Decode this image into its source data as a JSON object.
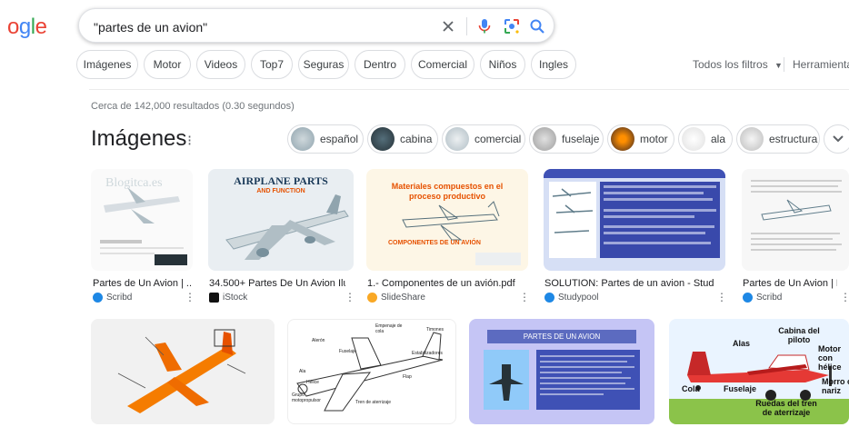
{
  "logo": {
    "part1": "o",
    "part2": "g",
    "part3": "l",
    "part4": "e"
  },
  "search": {
    "value": "\"partes de un avion\""
  },
  "chips": [
    "Imágenes",
    "Motor",
    "Videos",
    "Top7",
    "Seguras",
    "Dentro",
    "Comercial",
    "Niños",
    "Ingles"
  ],
  "tools": {
    "filters": "Todos los filtros",
    "herramientas": "Herramientas"
  },
  "stats": "Cerca de 142,000 resultados (0.30 segundos)",
  "images_section": {
    "title": "Imágenes",
    "pills": [
      "español",
      "cabina",
      "comercial",
      "fuselaje",
      "motor",
      "ala",
      "estructura"
    ]
  },
  "results": [
    {
      "caption": "Partes de Un Avion | ...",
      "source": "Scribd",
      "image_text": [
        "Blogitca.es"
      ]
    },
    {
      "caption": "34.500+ Partes De Un Avion Ilu...",
      "source": "iStock",
      "image_text": [
        "AIRPLANE PARTS",
        "AND FUNCTION"
      ]
    },
    {
      "caption": "1.- Componentes de un avión.pdf",
      "source": "SlideShare",
      "image_text": [
        "Materiales compuestos en el proceso productivo",
        "COMPONENTES DE UN AVIÓN"
      ]
    },
    {
      "caption": "SOLUTION: Partes de un avion - Studyp...",
      "source": "Studypool",
      "image_text": []
    },
    {
      "caption": "Partes de Un Avion | P...",
      "source": "Scribd",
      "image_text": []
    }
  ],
  "row2": {
    "plane_labels": [
      "Alerón",
      "Fuselaje",
      "Empenaje de cola",
      "Timones",
      "Estabilizadores",
      "Ala",
      "Hélice",
      "Grupo motopropulsor",
      "Flap",
      "Tren de aterrizaje"
    ],
    "slide_title": "PARTES DE UN AVION",
    "diagram_labels": [
      "Alas",
      "Cabina del piloto",
      "Motor con hélice",
      "Cola",
      "Fuselaje",
      "Morro o nariz",
      "Ruedas del tren de aterrizaje"
    ]
  },
  "colors": {
    "blue": "#4285f4",
    "green": "#34a853",
    "red": "#ea4335",
    "yellow": "#fbbc05"
  }
}
